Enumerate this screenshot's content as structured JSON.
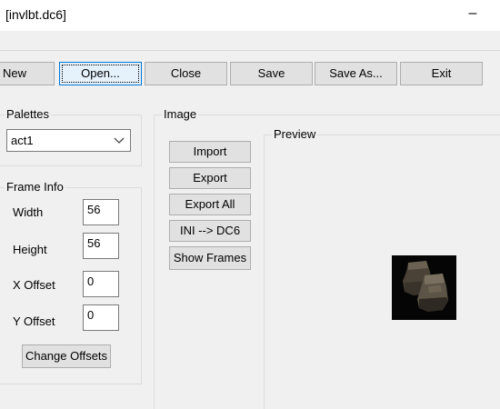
{
  "window": {
    "title": "[invlbt.dc6]",
    "minimize_glyph": "–"
  },
  "toolbar": {
    "new_label": "New",
    "open_label": "Open...",
    "close_label": "Close",
    "save_label": "Save",
    "save_as_label": "Save As...",
    "exit_label": "Exit"
  },
  "palettes": {
    "group_label": "Palettes",
    "selected": "act1"
  },
  "frame_info": {
    "group_label": "Frame Info",
    "width_label": "Width",
    "width_value": "56",
    "height_label": "Height",
    "height_value": "56",
    "x_offset_label": "X Offset",
    "x_offset_value": "0",
    "y_offset_label": "Y Offset",
    "y_offset_value": "0",
    "change_offsets_label": "Change Offsets"
  },
  "image": {
    "group_label": "Image",
    "import_label": "Import",
    "export_label": "Export",
    "export_all_label": "Export All",
    "ini_to_dc6_label": "INI --> DC6",
    "show_frames_label": "Show Frames"
  },
  "preview": {
    "group_label": "Preview",
    "image_icon": "boots-icon"
  }
}
